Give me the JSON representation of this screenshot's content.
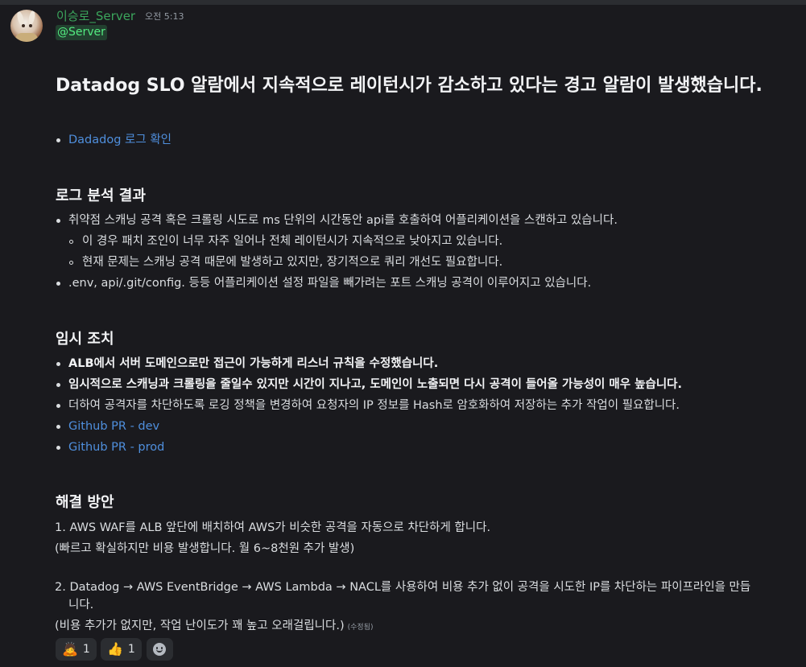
{
  "message": {
    "author": "이승로_Server",
    "time": "오전 5:13",
    "mention": "@Server",
    "title": "Datadog SLO 알람에서 지속적으로 레이턴시가 감소하고 있다는 경고 알람이 발생했습니다.",
    "title_link": "Dadadog 로그 확인",
    "sections": {
      "analysis": {
        "heading": "로그 분석 결과",
        "item1": "취약점 스캐닝 공격 혹은 크롤링 시도로 ms 단위의 시간동안 api를 호출하여 어플리케이션을 스캔하고 있습니다.",
        "sub1": "이 경우 패치 조인이 너무 자주 일어나 전체 레이턴시가 지속적으로 낮아지고 있습니다.",
        "sub2": "현재 문제는 스캐닝 공격 때문에 발생하고 있지만, 장기적으로 쿼리 개선도 필요합니다.",
        "item2": ".env, api/.git/config. 등등 어플리케이션 설정 파일을 빼가려는 포트 스캐닝 공격이 이루어지고 있습니다."
      },
      "temporary": {
        "heading": "임시 조치",
        "item1": "ALB에서 서버 도메인으로만 접근이 가능하게 리스너 규칙을 수정했습니다.",
        "item2": "임시적으로 스캐닝과 크롤링을 줄일수 있지만 시간이 지나고, 도메인이 노출되면 다시 공격이 들어올 가능성이 매우 높습니다.",
        "item3": "더하여 공격자를 차단하도록 로깅 정책을 변경하여 요청자의 IP 정보를 Hash로 암호화하여 저장하는 추가 작업이 필요합니다.",
        "link1": "Github PR - dev",
        "link2": "Github PR - prod"
      },
      "solution": {
        "heading": "해결 방안",
        "item1": "1. AWS WAF를 ALB 앞단에 배치하여 AWS가 비슷한 공격을 자동으로 차단하게 합니다.",
        "item1_note": "(빠르고 확실하지만 비용 발생합니다. 월 6~8천원 추가 발생)",
        "item2_line1": "2. Datadog → AWS EventBridge → AWS Lambda → NACL를 사용하여 비용 추가 없이 공격을 시도한 IP를 차단하는 파이프라인을 만듭",
        "item2_line2": "니다.",
        "item2_note": "(비용 추가가 없지만, 작업 난이도가 꽤 높고 오래걸립니다.)",
        "edited": "(수정됨)"
      }
    },
    "reactions": [
      {
        "emoji": "person-bowing",
        "glyph": "🙇",
        "count": "1"
      },
      {
        "emoji": "thumbs-up",
        "glyph": "👍",
        "count": "1"
      }
    ]
  }
}
